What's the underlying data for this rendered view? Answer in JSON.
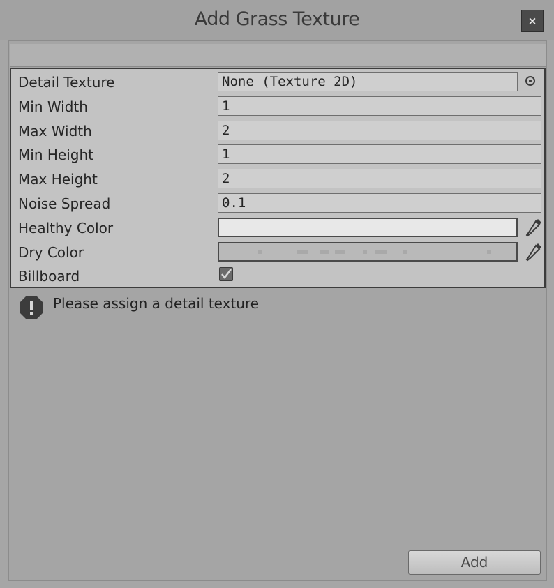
{
  "window": {
    "title": "Add Grass Texture",
    "close_label": "×"
  },
  "form": {
    "detail_texture": {
      "label": "Detail Texture",
      "value": "None (Texture 2D)",
      "picker_icon": "object-picker-icon"
    },
    "min_width": {
      "label": "Min Width",
      "value": "1"
    },
    "max_width": {
      "label": "Max Width",
      "value": "2"
    },
    "min_height": {
      "label": "Min Height",
      "value": "1"
    },
    "max_height": {
      "label": "Max Height",
      "value": "2"
    },
    "noise_spread": {
      "label": "Noise Spread",
      "value": "0.1"
    },
    "healthy_color": {
      "label": "Healthy Color",
      "color": "#e8e8e8",
      "picker_icon": "eyedropper-icon"
    },
    "dry_color": {
      "label": "Dry Color",
      "color": "#b9b9b9",
      "picker_icon": "eyedropper-icon"
    },
    "billboard": {
      "label": "Billboard",
      "checked": true
    }
  },
  "help": {
    "icon": "warning-icon",
    "message": "Please assign a detail texture"
  },
  "actions": {
    "add_label": "Add"
  }
}
